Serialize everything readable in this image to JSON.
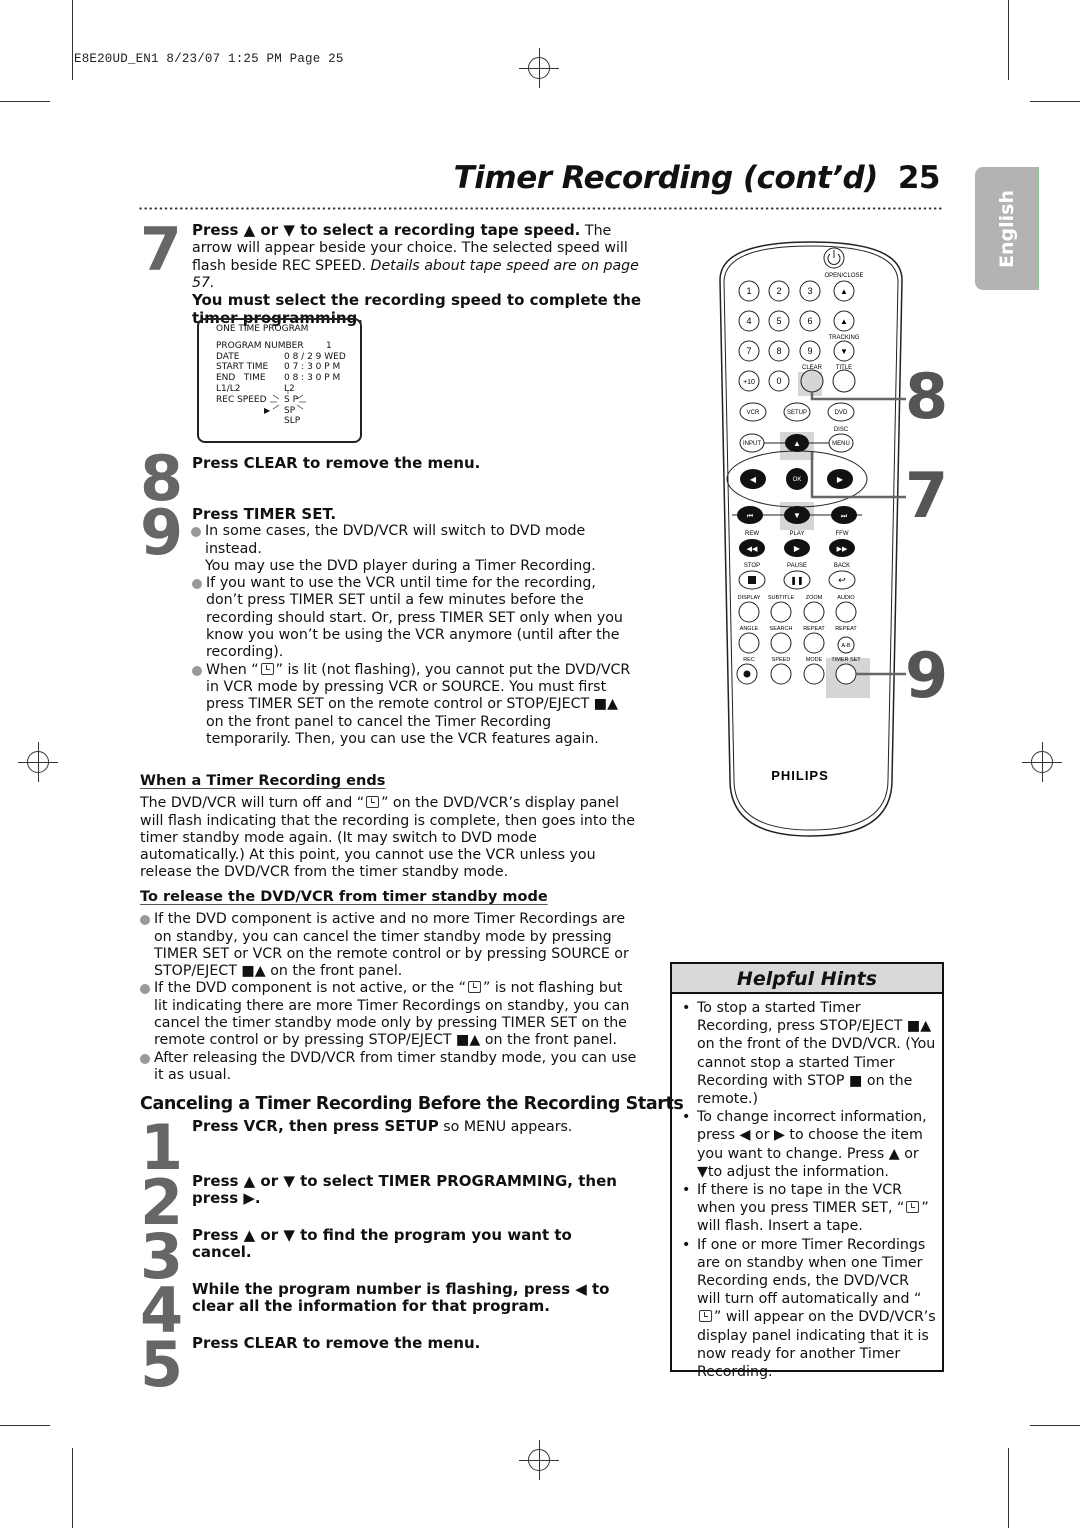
{
  "slug": "E8E20UD_EN1  8/23/07  1:25 PM  Page 25",
  "header": {
    "title": "Timer Recording (cont’d)",
    "page_number": "25",
    "language_tab": "English"
  },
  "step7": {
    "number": "7",
    "bold_lead": "Press ▲ or ▼ to select a recording tape speed.",
    "text": " The arrow will appear beside your choice. The selected speed will flash beside REC SPEED. ",
    "italic": "Details about tape speed are on page 57.",
    "bold_tail": "You must select the recording speed to complete the timer programming."
  },
  "osd": {
    "title": "ONE TIME PROGRAM",
    "rows": [
      {
        "label": "PROGRAM NUMBER",
        "value": "1"
      },
      {
        "label": "DATE",
        "value": "0 8 / 2 9  WED"
      },
      {
        "label": "START TIME",
        "value": "0 7 : 3 0  P M"
      },
      {
        "label": "END   TIME",
        "value": "0 8 : 3 0  P M"
      },
      {
        "label": "L1/L2",
        "value": "L2"
      },
      {
        "label": "REC SPEED",
        "value": "S P"
      }
    ],
    "options": [
      "SP",
      "SLP"
    ],
    "selected_option": "SP"
  },
  "step8": {
    "number": "8",
    "text": "Press CLEAR to remove the menu."
  },
  "step9": {
    "number": "9",
    "title": "Press TIMER SET.",
    "bullet1": "In some cases, the DVD/VCR will switch to DVD mode instead.",
    "bullet1_extra": "You may use the DVD player during a Timer Recording.",
    "bullet2": "If you want to use the VCR until time for the recording, don’t press TIMER SET until a few minutes before the recording should start. Or, press TIMER SET only when you know you won’t be using the VCR anymore (until after the recording).",
    "bullet3_a": "When “",
    "bullet3_b": "” is lit (not flashing), you cannot put the DVD/VCR in VCR mode by pressing VCR or SOURCE. You must first press TIMER SET on the remote control or STOP/EJECT ■▲ on the front panel to cancel the Timer Recording temporarily. Then, you can use the VCR features again."
  },
  "timer_ends": {
    "heading": "When a Timer Recording ends",
    "text_a": "The DVD/VCR will turn off and “",
    "text_b": "” on the DVD/VCR’s display panel will flash indicating that the recording is complete, then goes into the timer standby mode again. (It may switch to DVD mode automatically.) At this point, you cannot use the VCR unless you release the DVD/VCR from the timer standby mode."
  },
  "release": {
    "heading": "To release the DVD/VCR from timer standby mode",
    "bullet1": "If the DVD component is active and no more Timer Recordings are on standby, you can cancel the timer standby mode by pressing TIMER SET or VCR on the remote control or by pressing SOURCE or STOP/EJECT ■▲ on the front panel.",
    "bullet2_a": "If the DVD component is not active, or the “",
    "bullet2_b": "” is not flashing but lit indicating there are more Timer Recordings on standby, you can cancel the timer standby mode only by pressing TIMER SET on the remote control or by pressing STOP/EJECT ■▲ on the front panel.",
    "bullet3": "After releasing the DVD/VCR from timer standby mode, you can use it as usual."
  },
  "cancel_section": {
    "heading": "Canceling a Timer Recording Before the Recording Starts",
    "steps": [
      {
        "number": "1",
        "bold": "Press VCR, then press SETUP",
        "text": " so MENU appears."
      },
      {
        "number": "2",
        "bold": "Press ▲ or ▼ to select TIMER PROGRAMMING, then press ▶.",
        "text": ""
      },
      {
        "number": "3",
        "bold": "Press ▲ or ▼ to find the program you want to cancel.",
        "text": ""
      },
      {
        "number": "4",
        "bold": "While the program number is flashing, press ◀ to clear all the information for that program.",
        "text": ""
      },
      {
        "number": "5",
        "bold": "Press CLEAR to remove the menu.",
        "text": ""
      }
    ]
  },
  "remote": {
    "brand": "PHILIPS",
    "labels": {
      "open_close": "OPEN/CLOSE",
      "tracking": "TRACKING",
      "clear": "CLEAR",
      "title": "TITLE",
      "disc": "DISC",
      "rew": "REW",
      "play": "PLAY",
      "ffw": "FFW",
      "stop": "STOP",
      "pause": "PAUSE",
      "back": "BACK",
      "display": "DISPLAY",
      "subtitle": "SUBTITLE",
      "zoom": "ZOOM",
      "audio": "AUDIO",
      "angle": "ANGLE",
      "search": "SEARCH",
      "repeat": "REPEAT",
      "repeat2": "REPEAT",
      "rec": "REC",
      "speed": "SPEED",
      "mode": "MODE",
      "timer_set": "TIMER SET"
    },
    "buttons": {
      "n1": "1",
      "n2": "2",
      "n3": "3",
      "n4": "4",
      "n5": "5",
      "n6": "6",
      "n7": "7",
      "n8": "8",
      "n9": "9",
      "plus10": "+10",
      "n0": "0",
      "vcr": "VCR",
      "setup": "SETUP",
      "dvd": "DVD",
      "input": "INPUT",
      "menu": "MENU",
      "ok": "OK",
      "ab": "A-B"
    },
    "callouts": [
      "8",
      "7",
      "9"
    ]
  },
  "hints": {
    "title": "Helpful Hints",
    "items": [
      "To stop a started Timer Recording, press STOP/EJECT ■▲ on the front of the DVD/VCR. (You cannot stop a started Timer Recording with STOP ■ on the remote.)",
      "To change incorrect information, press ◀ or ▶ to choose the item you want to change. Press ▲ or ▼to adjust the information."
    ],
    "item3_a": "If there is no tape in the VCR when you press TIMER SET, “",
    "item3_b": "” will flash. Insert a tape.",
    "item4_a": "If one or more Timer Recordings are on standby when one Timer Recording ends, the DVD/VCR will turn off automatically and “",
    "item4_b": "” will appear on the DVD/VCR’s display panel indicating that it is now ready for another Timer Recording."
  }
}
